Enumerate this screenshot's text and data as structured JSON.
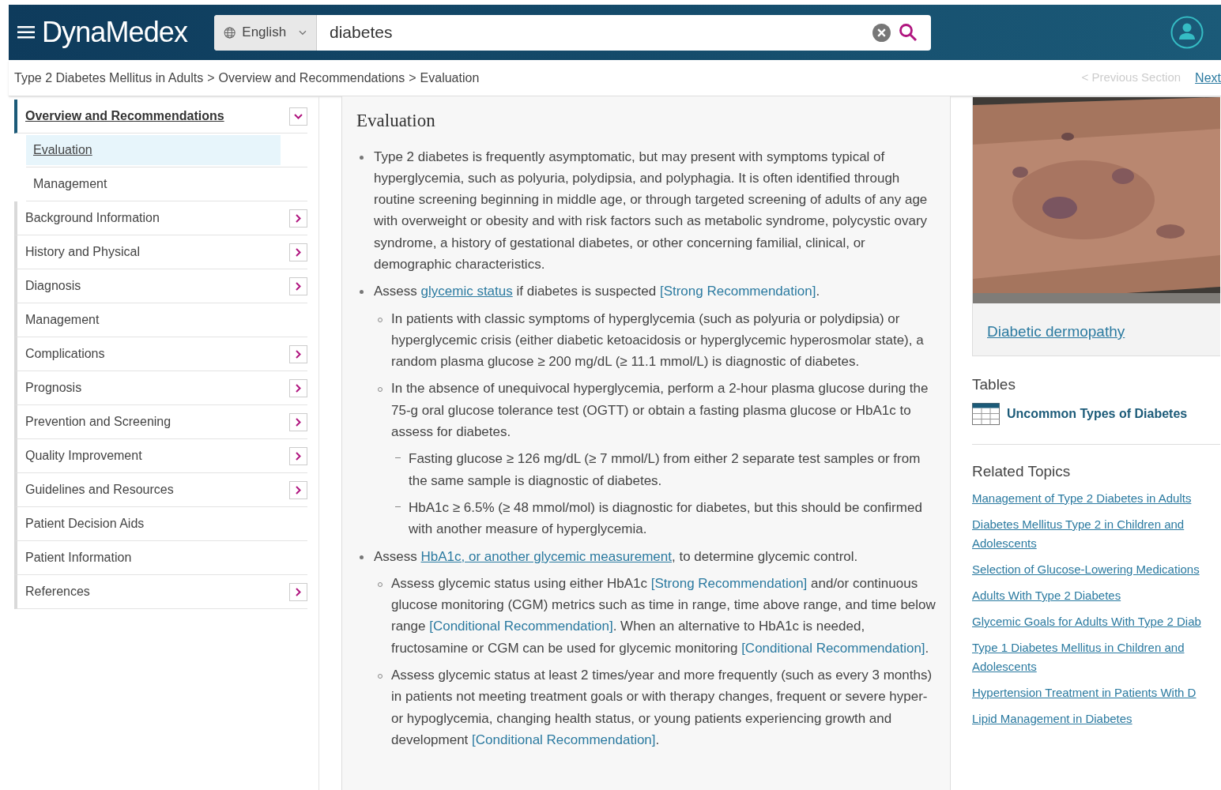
{
  "header": {
    "logo": "DynaMedex",
    "language": "English",
    "search_value": "diabetes"
  },
  "breadcrumb": [
    "Type 2 Diabetes Mellitus in Adults",
    "Overview and Recommendations",
    "Evaluation"
  ],
  "breadcrumb_separator": ">",
  "section_nav": {
    "previous": "< Previous Section",
    "next": "Next"
  },
  "sidebar": {
    "items": [
      {
        "label": "Overview and Recommendations",
        "kind": "collapsible",
        "expanded": true,
        "selected": true,
        "children": [
          {
            "label": "Evaluation",
            "selected": true
          },
          {
            "label": "Management",
            "selected": false
          }
        ]
      },
      {
        "label": "Background Information",
        "kind": "collapsible",
        "expanded": false,
        "selected": false
      },
      {
        "label": "History and Physical",
        "kind": "collapsible",
        "expanded": false,
        "selected": false
      },
      {
        "label": "Diagnosis",
        "kind": "collapsible",
        "expanded": false,
        "selected": false
      },
      {
        "label": "Management",
        "kind": "leaf",
        "selected": false
      },
      {
        "label": "Complications",
        "kind": "collapsible",
        "expanded": false,
        "selected": false
      },
      {
        "label": "Prognosis",
        "kind": "collapsible",
        "expanded": false,
        "selected": false
      },
      {
        "label": "Prevention and Screening",
        "kind": "collapsible",
        "expanded": false,
        "selected": false
      },
      {
        "label": "Quality Improvement",
        "kind": "collapsible",
        "expanded": false,
        "selected": false
      },
      {
        "label": "Guidelines and Resources",
        "kind": "collapsible",
        "expanded": false,
        "selected": false
      },
      {
        "label": "Patient Decision Aids",
        "kind": "leaf",
        "selected": false
      },
      {
        "label": "Patient Information",
        "kind": "leaf",
        "selected": false
      },
      {
        "label": "References",
        "kind": "collapsible",
        "expanded": false,
        "selected": false
      }
    ]
  },
  "article": {
    "heading": "Evaluation",
    "bullets": [
      {
        "segments": [
          {
            "kind": "text",
            "text": "Type 2 diabetes is frequently asymptomatic, but may present with symptoms typical of hyperglycemia, such as polyuria, polydipsia, and polyphagia. It is often identified through routine screening beginning in middle age, or through targeted screening of adults of any age with overweight or obesity and with risk factors such as metabolic syndrome, polycystic ovary syndrome, a history of gestational diabetes, or other concerning familial, clinical, or demographic characteristics."
          }
        ]
      },
      {
        "segments": [
          {
            "kind": "text",
            "text": "Assess "
          },
          {
            "kind": "link",
            "text": "glycemic status"
          },
          {
            "kind": "text",
            "text": " if diabetes is suspected "
          },
          {
            "kind": "tag",
            "text": "[Strong Recommendation]"
          },
          {
            "kind": "text",
            "text": "."
          }
        ],
        "children": [
          {
            "segments": [
              {
                "kind": "text",
                "text": "In patients with classic symptoms of hyperglycemia (such as polyuria or polydipsia) or hyperglycemic crisis (either diabetic ketoacidosis or hyperglycemic hyperosmolar state), a random plasma glucose ≥ 200 mg/dL (≥ 11.1 mmol/L) is diagnostic of diabetes."
              }
            ]
          },
          {
            "segments": [
              {
                "kind": "text",
                "text": "In the absence of unequivocal hyperglycemia, perform a 2-hour plasma glucose during the 75-g oral glucose tolerance test (OGTT) or obtain a fasting plasma glucose or HbA1c to assess for diabetes."
              }
            ],
            "children": [
              {
                "segments": [
                  {
                    "kind": "text",
                    "text": "Fasting glucose ≥ 126 mg/dL (≥ 7 mmol/L) from either 2 separate test samples or from the same sample is diagnostic of diabetes."
                  }
                ]
              },
              {
                "segments": [
                  {
                    "kind": "text",
                    "text": "HbA1c ≥ 6.5% (≥ 48 mmol/mol) is diagnostic for diabetes, but this should be confirmed with another measure of hyperglycemia."
                  }
                ]
              }
            ]
          }
        ]
      },
      {
        "segments": [
          {
            "kind": "text",
            "text": "Assess "
          },
          {
            "kind": "link",
            "text": "HbA1c, or another glycemic measurement"
          },
          {
            "kind": "text",
            "text": ", to determine glycemic control."
          }
        ],
        "children": [
          {
            "segments": [
              {
                "kind": "text",
                "text": "Assess glycemic status using either HbA1c "
              },
              {
                "kind": "tag",
                "text": "[Strong Recommendation]"
              },
              {
                "kind": "text",
                "text": " and/or continuous glucose monitoring (CGM) metrics such as time in range, time above range, and time below range "
              },
              {
                "kind": "tag",
                "text": "[Conditional Recommendation]"
              },
              {
                "kind": "text",
                "text": ". When an alternative to HbA1c is needed, fructosamine or CGM can be used for glycemic monitoring "
              },
              {
                "kind": "tag",
                "text": "[Conditional Recommendation]"
              },
              {
                "kind": "text",
                "text": "."
              }
            ]
          },
          {
            "segments": [
              {
                "kind": "text",
                "text": "Assess glycemic status at least 2 times/year and more frequently (such as every 3 months) in patients not meeting treatment goals or with therapy changes, frequent or severe hyper- or hypoglycemia, changing health status, or young patients experiencing growth and development "
              },
              {
                "kind": "tag",
                "text": "[Conditional Recommendation]"
              },
              {
                "kind": "text",
                "text": "."
              }
            ]
          }
        ]
      }
    ]
  },
  "aside": {
    "image": {
      "kind": "picture",
      "caption": "Diabetic dermopathy"
    },
    "tables_heading": "Tables",
    "tables": [
      "Uncommon Types of Diabetes"
    ],
    "related_heading": "Related Topics",
    "related": [
      "Management of Type 2 Diabetes in Adults",
      "Diabetes Mellitus Type 2 in Children and Adolescents",
      "Selection of Glucose-Lowering Medications",
      "Adults With Type 2 Diabetes",
      "Glycemic Goals for Adults With Type 2 Diab",
      "Type 1 Diabetes Mellitus in Children and Adolescents",
      "Hypertension Treatment in Patients With D",
      "Lipid Management in Diabetes"
    ]
  }
}
